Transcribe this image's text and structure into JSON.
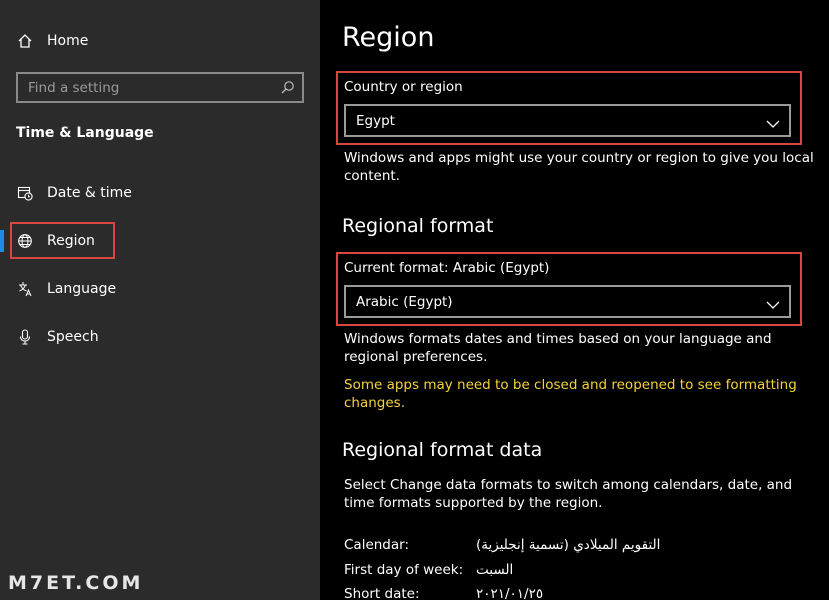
{
  "sidebar": {
    "home_label": "Home",
    "search_placeholder": "Find a setting",
    "section_title": "Time & Language",
    "items": [
      {
        "label": "Date & time",
        "icon": "calendar-clock-icon"
      },
      {
        "label": "Region",
        "icon": "globe-icon",
        "selected": true
      },
      {
        "label": "Language",
        "icon": "language-icon"
      },
      {
        "label": "Speech",
        "icon": "microphone-icon"
      }
    ]
  },
  "main": {
    "title": "Region",
    "country": {
      "label": "Country or region",
      "value": "Egypt",
      "description": "Windows and apps might use your country or region to give you local content."
    },
    "regional_format": {
      "heading": "Regional format",
      "label": "Current format: Arabic (Egypt)",
      "value": "Arabic (Egypt)",
      "description": "Windows formats dates and times based on your language and regional preferences.",
      "warning": "Some apps may need to be closed and reopened to see formatting changes."
    },
    "format_data": {
      "heading": "Regional format data",
      "description": "Select Change data formats to switch among calendars, date, and time formats supported by the region.",
      "rows": [
        {
          "key": "Calendar:",
          "value": "التقويم الميلادي (تسمية إنجليزية)"
        },
        {
          "key": "First day of week:",
          "value": "السبت"
        },
        {
          "key": "Short date:",
          "value": "٢٠٢١/٠١/٢٥"
        }
      ]
    }
  },
  "watermark": "M7ET.COM",
  "colors": {
    "accent": "#1f8ae8",
    "highlight_box": "#d9453f",
    "warning_text": "#f5d23a",
    "sidebar_bg": "#2b2b2b",
    "main_bg": "#000000"
  }
}
